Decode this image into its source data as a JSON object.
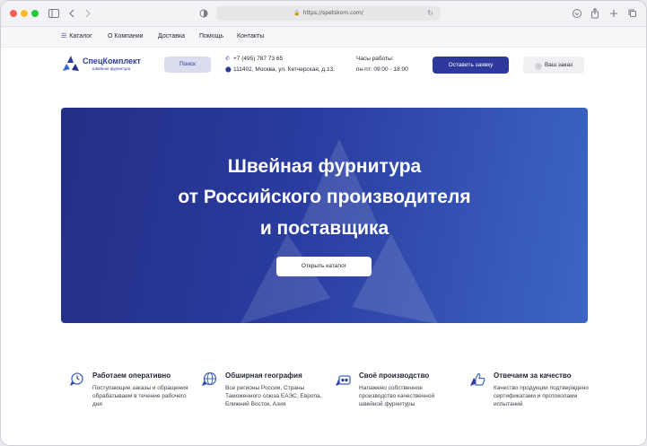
{
  "browser": {
    "url": "https://spetskom.com/"
  },
  "nav": {
    "items": [
      {
        "label": "Каталог"
      },
      {
        "label": "О Компании"
      },
      {
        "label": "Доставка"
      },
      {
        "label": "Помощь"
      },
      {
        "label": "Контакты"
      }
    ]
  },
  "header": {
    "logo_name": "СпецКомплект",
    "logo_sub": "швейная фурнитура",
    "search_label": "Поиск",
    "phone": "+7 (495) 787 73 65",
    "address": "111402, Москва, ул. Кетчерская, д.13.",
    "hours_label": "Часы работы:",
    "hours_value": "пн-пт: 09:00 - 18:00",
    "cta_label": "Оставить заявку",
    "order_label": "Ваш заказ"
  },
  "hero": {
    "line1": "Швейная фурнитура",
    "line2": "от Российского производителя",
    "line3": "и поставщика",
    "button": "Открыть каталог"
  },
  "features": [
    {
      "title": "Работаем оперативно",
      "desc": "Поступающие заказы и обращения обрабатываем в течение рабочего дня",
      "icon": "clock-icon"
    },
    {
      "title": "Обширная география",
      "desc": "Все регионы России, Страны Таможенного союза ЕАЭС, Европа, Ближний Восток, Азия",
      "icon": "globe-icon"
    },
    {
      "title": "Своё производство",
      "desc": "Налажено собственное производство качественной швейной фурнитуры",
      "icon": "factory-icon"
    },
    {
      "title": "Отвечаем за качество",
      "desc": "Качество продукции подтверждено сертификатами и протоколами испытаний",
      "icon": "thumbs-up-icon"
    }
  ],
  "colors": {
    "brand": "#2d3a9c",
    "hero_start": "#232f86",
    "hero_end": "#3d66c4"
  }
}
